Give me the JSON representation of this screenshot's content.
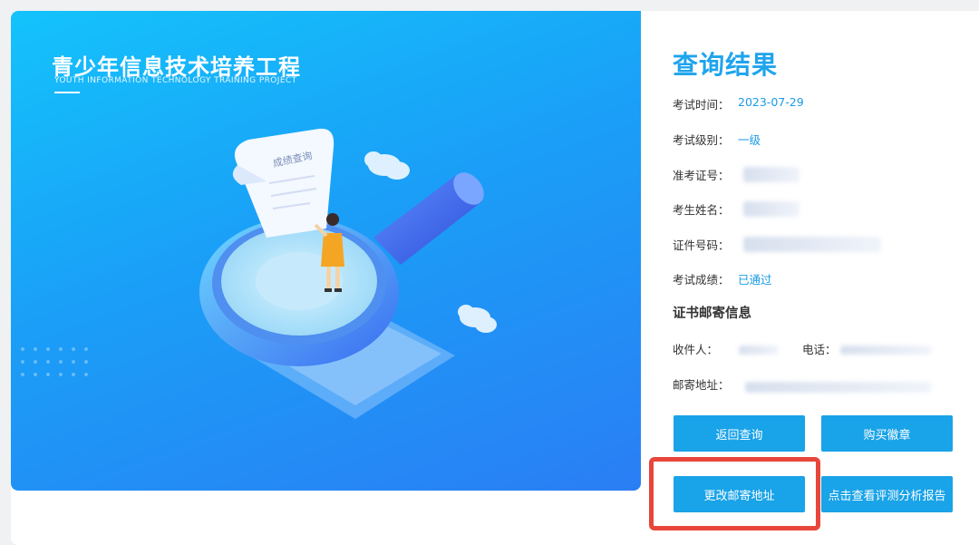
{
  "hero": {
    "title": "青少年信息技术培养工程",
    "subtitle": "YOUTH INFORMATION TECHNOLOGY TRAINING PROJECT",
    "scroll_label": "成绩查询"
  },
  "result": {
    "title": "查询结果",
    "fields": [
      {
        "label": "考试时间：",
        "value": "2023-07-29"
      },
      {
        "label": "考试级别：",
        "value": "一级"
      },
      {
        "label": "准考证号：",
        "value": ""
      },
      {
        "label": "考生姓名：",
        "value": ""
      },
      {
        "label": "证件号码：",
        "value": ""
      },
      {
        "label": "考试成绩：",
        "value": "已通过"
      }
    ]
  },
  "mail": {
    "section_title": "证书邮寄信息",
    "recipient_label": "收件人：",
    "phone_label": "电话：",
    "address_label": "邮寄地址："
  },
  "buttons": {
    "back": "返回查询",
    "buy_badge": "购买徽章",
    "change_address": "更改邮寄地址",
    "view_report": "点击查看评测分析报告"
  },
  "colors": {
    "accent": "#19a3e8",
    "highlight_border": "#e8463a",
    "hero_gradient_start": "#14c3fb",
    "hero_gradient_end": "#2a7ef4"
  }
}
